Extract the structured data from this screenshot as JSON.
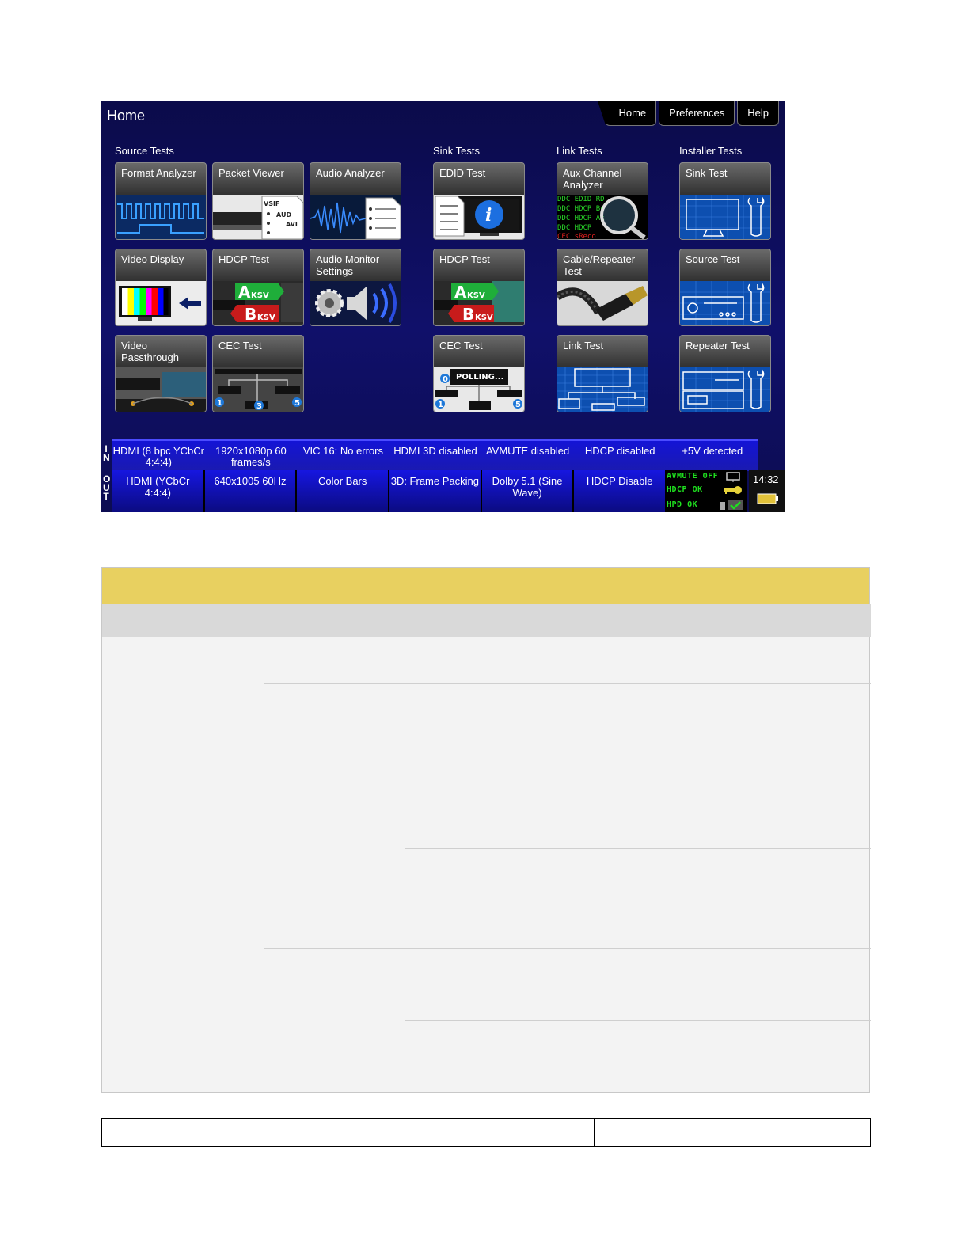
{
  "screen": {
    "title": "Home",
    "nav": [
      "Home",
      "Preferences",
      "Help"
    ],
    "sections": {
      "source": "Source Tests",
      "sink": "Sink Tests",
      "link": "Link Tests",
      "installer": "Installer Tests"
    },
    "tiles": {
      "format_analyzer": "Format Analyzer",
      "packet_viewer": "Packet Viewer",
      "audio_analyzer": "Audio Analyzer",
      "video_display": "Video Display",
      "hdcp_test_source": "HDCP Test",
      "audio_monitor": "Audio Monitor Settings",
      "video_passthrough": "Video Passthrough",
      "cec_test_source": "CEC Test",
      "edid_test": "EDID Test",
      "hdcp_test_sink": "HDCP Test",
      "cec_test_sink": "CEC Test",
      "aux_channel": "Aux Channel Analyzer",
      "cable_repeater": "Cable/Repeater Test",
      "link_test": "Link Test",
      "sink_test": "Sink Test",
      "source_test": "Source Test",
      "repeater_test": "Repeater Test"
    },
    "tile_art_text": {
      "vsif": "VSIF",
      "aud": "AUD",
      "avi": "AVI",
      "aksv": "A",
      "aksv_sub": "KSV",
      "bksv": "B",
      "bksv_sub": "KSV",
      "polling": "POLLING...",
      "cec_nums": [
        "1",
        "3",
        "5",
        "0"
      ],
      "ddc_lines": [
        "DDC EDID RD",
        "DDC HDCP Bc",
        "DDC HDCP Ak",
        "DDC HDCP",
        "CEC sReco"
      ]
    },
    "in_label": "IN",
    "out_label": "OUT",
    "in_status": [
      "HDMI (8 bpc YCbCr 4:4:4)",
      "1920x1080p 60 frames/s",
      "VIC 16: No errors",
      "HDMI 3D disabled",
      "AVMUTE disabled",
      "HDCP disabled",
      "+5V detected"
    ],
    "out_status": [
      "HDMI (YCbCr 4:4:4)",
      "640x1005 60Hz",
      "Color Bars",
      "3D: Frame Packing",
      "Dolby 5.1 (Sine Wave)",
      "HDCP Disable"
    ],
    "indicators": {
      "avmute": "AVMUTE OFF",
      "hdcp": "HDCP OK",
      "hpd": "HPD OK"
    },
    "time": "14:32",
    "colors": {
      "background": "#0c0c5a",
      "bar_blue": "#1616e0",
      "indicator_green": "#1fe01f",
      "table_header": "#e8d060"
    }
  }
}
